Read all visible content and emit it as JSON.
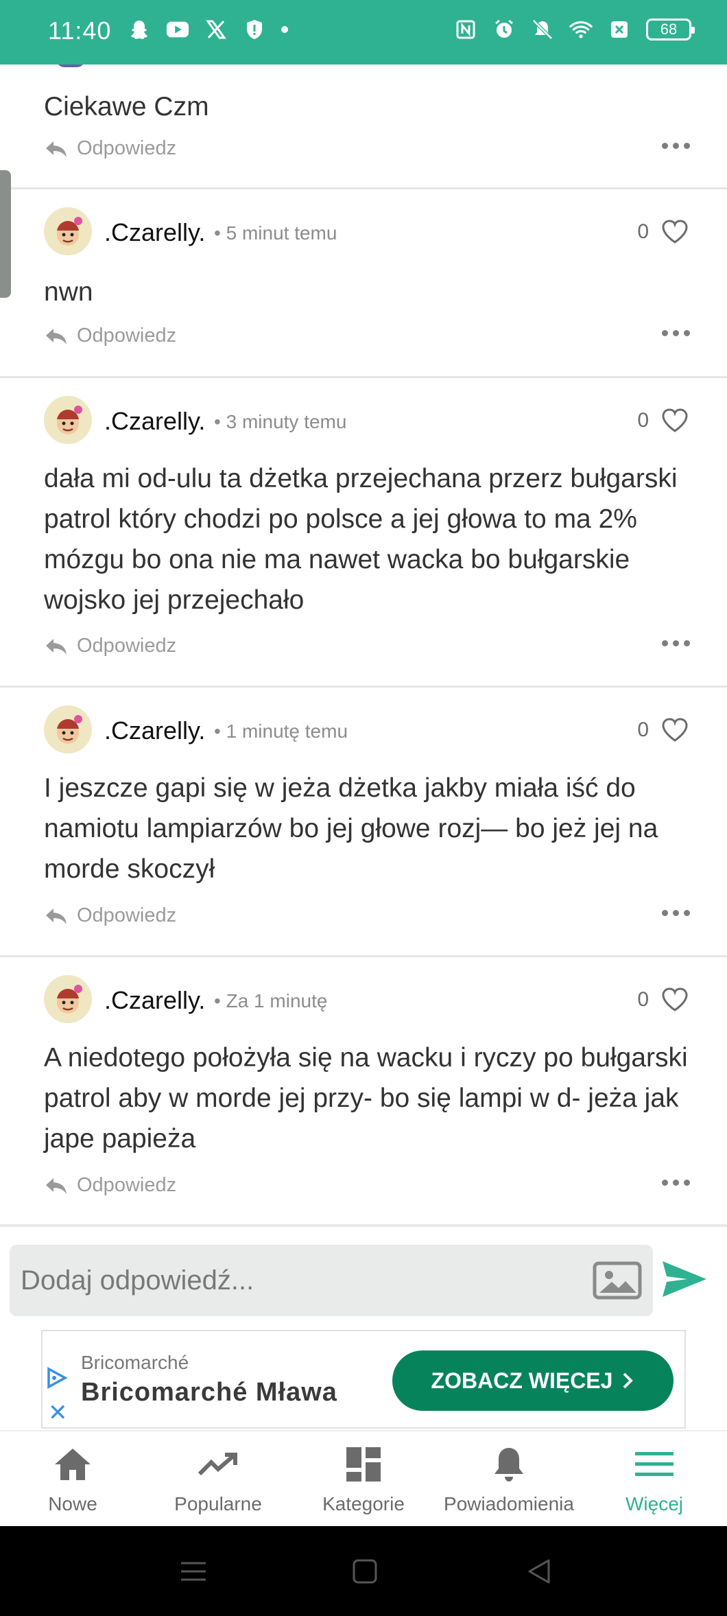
{
  "status_bar": {
    "time": "11:40",
    "battery": "68",
    "left_icons": [
      "snapchat-icon",
      "youtube-icon",
      "x-icon",
      "shield-icon",
      "dot"
    ],
    "right_icons": [
      "nfc-icon",
      "alarm-icon",
      "mute-icon",
      "wifi-icon",
      "sim-off-icon",
      "battery-icon"
    ]
  },
  "colors": {
    "brand": "#2fb291",
    "cta": "#07835c"
  },
  "top_comment": {
    "text": "Ciekawe Czm",
    "reply_label": "Odpowiedz"
  },
  "comments": [
    {
      "user": ".Czarelly.",
      "time": "5 minut temu",
      "likes": "0",
      "text": "nwn",
      "reply_label": "Odpowiedz"
    },
    {
      "user": ".Czarelly.",
      "time": "3 minuty temu",
      "likes": "0",
      "text": "dała mi od-ulu ta dżetka przejechana przerz bułgarski patrol który chodzi po polsce a jej głowa to ma 2% mózgu bo ona nie ma nawet wacka bo bułgarskie wojsko jej przejechało",
      "reply_label": "Odpowiedz"
    },
    {
      "user": ".Czarelly.",
      "time": "1 minutę temu",
      "likes": "0",
      "text": "I jeszcze gapi się w jeża dżetka jakby miała iść do namiotu lampiarzów bo jej głowe rozj— bo jeż jej na morde skoczył",
      "reply_label": "Odpowiedz"
    },
    {
      "user": ".Czarelly.",
      "time": "Za 1 minutę",
      "likes": "0",
      "text": "A niedotego położyła się na wacku i ryczy po bułgarski patrol aby w morde jej przy- bo się lampi w d- jeża jak jape papieża",
      "reply_label": "Odpowiedz"
    }
  ],
  "reply_input": {
    "placeholder": "Dodaj odpowiedź..."
  },
  "ad": {
    "advertiser": "Bricomarché",
    "title": "Bricomarché Mława",
    "cta": "ZOBACZ WIĘCEJ"
  },
  "bottom_nav": [
    {
      "label": "Nowe",
      "icon": "home-icon"
    },
    {
      "label": "Popularne",
      "icon": "trending-icon"
    },
    {
      "label": "Kategorie",
      "icon": "categories-icon"
    },
    {
      "label": "Powiadomienia",
      "icon": "bell-icon"
    },
    {
      "label": "Więcej",
      "icon": "menu-icon",
      "active": true
    }
  ]
}
